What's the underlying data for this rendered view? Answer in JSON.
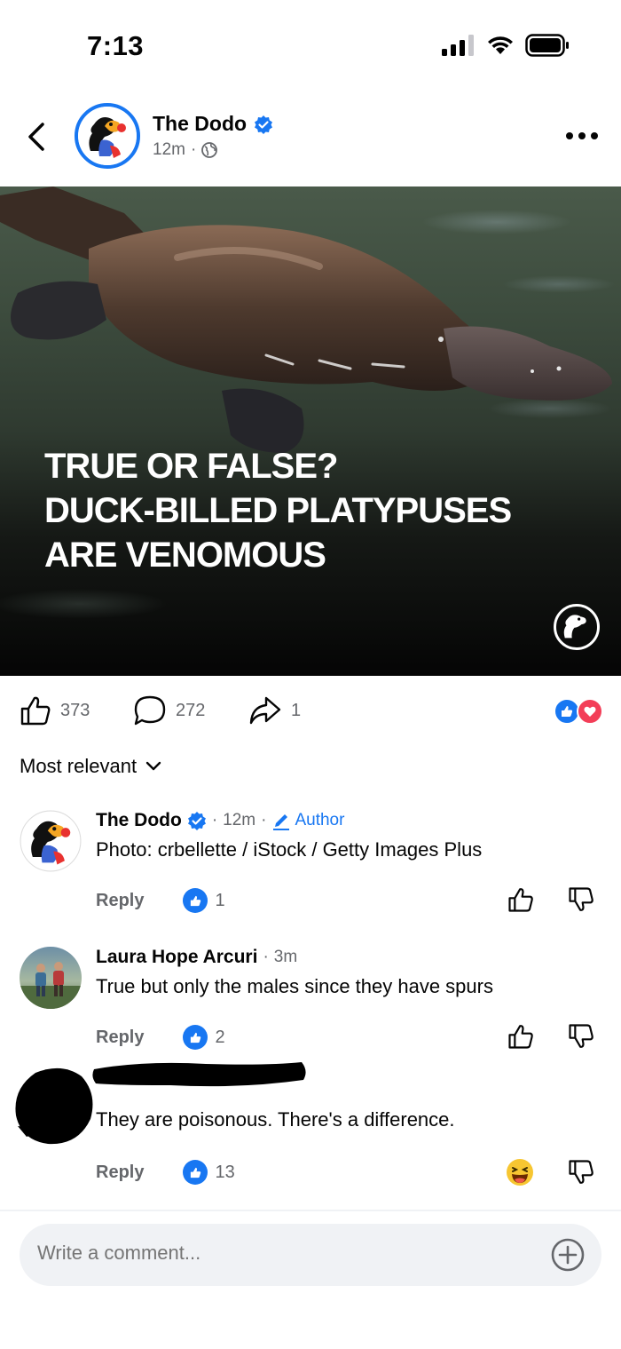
{
  "status": {
    "time": "7:13"
  },
  "post": {
    "page_name": "The Dodo",
    "time": "12m",
    "overlay_lines": [
      "TRUE OR FALSE?",
      "DUCK-BILLED PLATYPUSES",
      "ARE VENOMOUS"
    ],
    "likes": "373",
    "comments": "272",
    "shares": "1"
  },
  "sort": {
    "label": "Most relevant"
  },
  "comments": [
    {
      "name": "The Dodo",
      "time": "12m",
      "badge": "Author",
      "text": "Photo: crbellette / iStock / Getty Images Plus",
      "reply": "Reply",
      "like_count": "1"
    },
    {
      "name": "Laura Hope Arcuri",
      "time": "3m",
      "text": "True but only the males since they have spurs",
      "reply": "Reply",
      "like_count": "2"
    },
    {
      "text": "They are poisonous. There's a difference.",
      "reply": "Reply",
      "like_count": "13"
    }
  ],
  "composer": {
    "placeholder": "Write a comment..."
  },
  "colors": {
    "accent": "#1877f2",
    "love": "#f33e58",
    "secondary_text": "#65676b"
  }
}
